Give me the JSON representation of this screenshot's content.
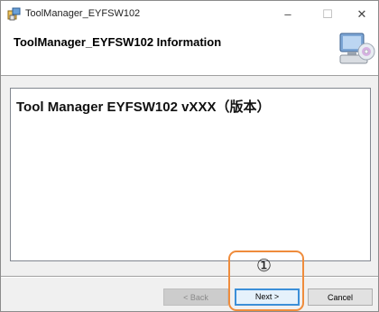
{
  "window": {
    "title": "ToolManager_EYFSW102",
    "icon": "installer-package-icon"
  },
  "caption": {
    "minimize": "–",
    "maximize": "☐",
    "close": "✕"
  },
  "header": {
    "title": "ToolManager_EYFSW102 Information",
    "icon": "computer-disc-icon"
  },
  "content": {
    "text": "Tool Manager EYFSW102 vXXX（版本）"
  },
  "buttons": {
    "back": "< Back",
    "next": "Next >",
    "cancel": "Cancel"
  },
  "annotation": {
    "step": "①",
    "color": "#ef8c3c"
  },
  "colors": {
    "dialog_bg": "#f0f0f0",
    "focus_border": "#3c8fd8"
  }
}
